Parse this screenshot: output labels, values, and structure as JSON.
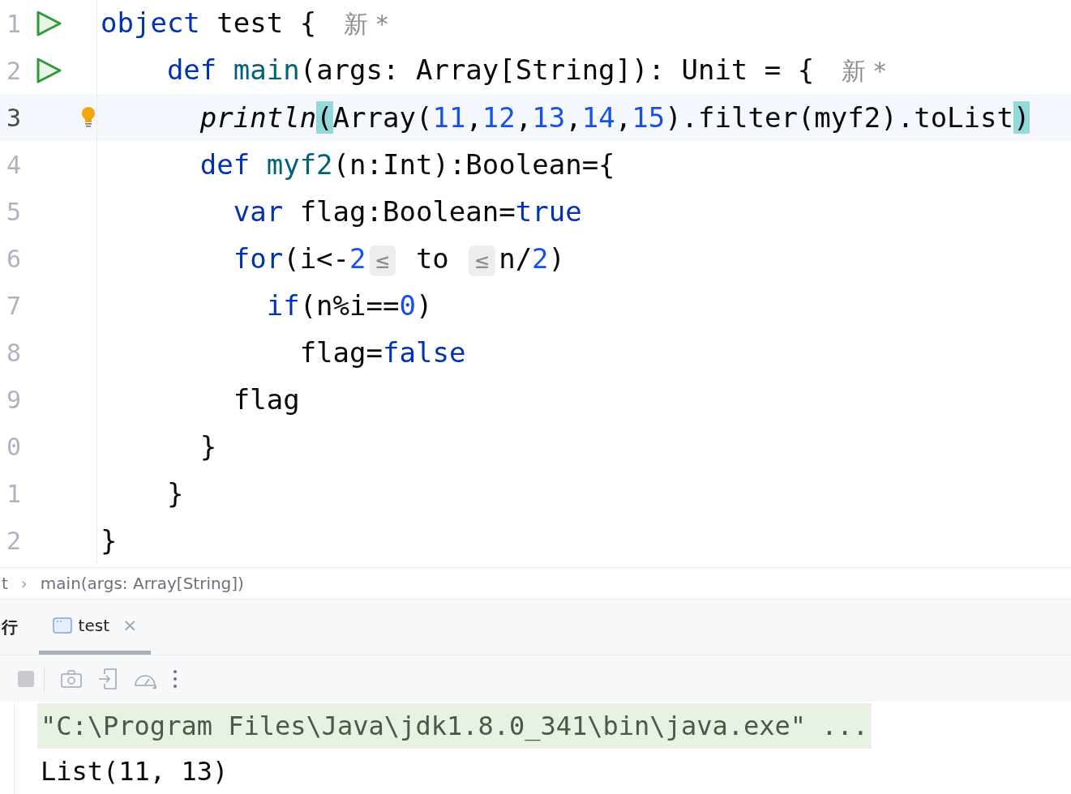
{
  "editor": {
    "lines": [
      {
        "number": "1",
        "run": true,
        "intention": false,
        "current": false,
        "tokens": [
          {
            "kind": "kw",
            "text": "object"
          },
          {
            "kind": "plain",
            "text": " test {"
          },
          {
            "kind": "author",
            "text": "新 *"
          }
        ]
      },
      {
        "number": "2",
        "run": true,
        "intention": false,
        "current": false,
        "tokens": [
          {
            "kind": "kw",
            "text": "    def"
          },
          {
            "kind": "fn",
            "text": " main"
          },
          {
            "kind": "plain",
            "text": "(args: Array[String]): Unit = {"
          },
          {
            "kind": "author",
            "text": "新 *"
          }
        ]
      },
      {
        "number": "3",
        "run": false,
        "intention": true,
        "current": true,
        "tokens": [
          {
            "kind": "italic",
            "text": "      println"
          },
          {
            "kind": "match",
            "text": "("
          },
          {
            "kind": "plain",
            "text": "Array("
          },
          {
            "kind": "num",
            "text": "11"
          },
          {
            "kind": "plain",
            "text": ","
          },
          {
            "kind": "num",
            "text": "12"
          },
          {
            "kind": "plain",
            "text": ","
          },
          {
            "kind": "num",
            "text": "13"
          },
          {
            "kind": "plain",
            "text": ","
          },
          {
            "kind": "num",
            "text": "14"
          },
          {
            "kind": "plain",
            "text": ","
          },
          {
            "kind": "num",
            "text": "15"
          },
          {
            "kind": "plain",
            "text": ").filter(myf2).toList"
          },
          {
            "kind": "match",
            "text": ")"
          }
        ]
      },
      {
        "number": "4",
        "run": false,
        "intention": false,
        "current": false,
        "tokens": [
          {
            "kind": "kw",
            "text": "      def"
          },
          {
            "kind": "fn",
            "text": " myf2"
          },
          {
            "kind": "plain",
            "text": "(n:Int):Boolean={"
          }
        ]
      },
      {
        "number": "5",
        "run": false,
        "intention": false,
        "current": false,
        "tokens": [
          {
            "kind": "kw",
            "text": "        var"
          },
          {
            "kind": "plain",
            "text": " flag:Boolean="
          },
          {
            "kind": "kw",
            "text": "true"
          }
        ]
      },
      {
        "number": "6",
        "run": false,
        "intention": false,
        "current": false,
        "tokens": [
          {
            "kind": "kw",
            "text": "        for"
          },
          {
            "kind": "plain",
            "text": "(i<-"
          },
          {
            "kind": "num",
            "text": "2"
          },
          {
            "kind": "hint",
            "text": "≤"
          },
          {
            "kind": "plain",
            "text": " to "
          },
          {
            "kind": "hint",
            "text": "≤"
          },
          {
            "kind": "plain",
            "text": "n/"
          },
          {
            "kind": "num",
            "text": "2"
          },
          {
            "kind": "plain",
            "text": ")"
          }
        ]
      },
      {
        "number": "7",
        "run": false,
        "intention": false,
        "current": false,
        "tokens": [
          {
            "kind": "kw",
            "text": "          if"
          },
          {
            "kind": "plain",
            "text": "(n%i=="
          },
          {
            "kind": "num",
            "text": "0"
          },
          {
            "kind": "plain",
            "text": ")"
          }
        ]
      },
      {
        "number": "8",
        "run": false,
        "intention": false,
        "current": false,
        "tokens": [
          {
            "kind": "plain",
            "text": "            flag="
          },
          {
            "kind": "kw",
            "text": "false"
          }
        ]
      },
      {
        "number": "9",
        "run": false,
        "intention": false,
        "current": false,
        "tokens": [
          {
            "kind": "plain",
            "text": "        flag"
          }
        ]
      },
      {
        "number": "0",
        "run": false,
        "intention": false,
        "current": false,
        "tokens": [
          {
            "kind": "plain",
            "text": "      }"
          }
        ]
      },
      {
        "number": "1",
        "run": false,
        "intention": false,
        "current": false,
        "tokens": [
          {
            "kind": "plain",
            "text": "    }"
          }
        ]
      },
      {
        "number": "2",
        "run": false,
        "intention": false,
        "current": false,
        "tokens": [
          {
            "kind": "plain",
            "text": "}"
          }
        ]
      }
    ]
  },
  "breadcrumb": {
    "items": [
      "t",
      "main(args: Array[String])"
    ],
    "separator": "›"
  },
  "run_panel": {
    "title": "行",
    "tabs": [
      {
        "label": "test",
        "selected": true,
        "close": "×"
      }
    ],
    "console": [
      {
        "kind": "command",
        "text": "\"C:\\Program Files\\Java\\jdk1.8.0_341\\bin\\java.exe\" ..."
      },
      {
        "kind": "output",
        "text": "List(11, 13)"
      }
    ]
  }
}
